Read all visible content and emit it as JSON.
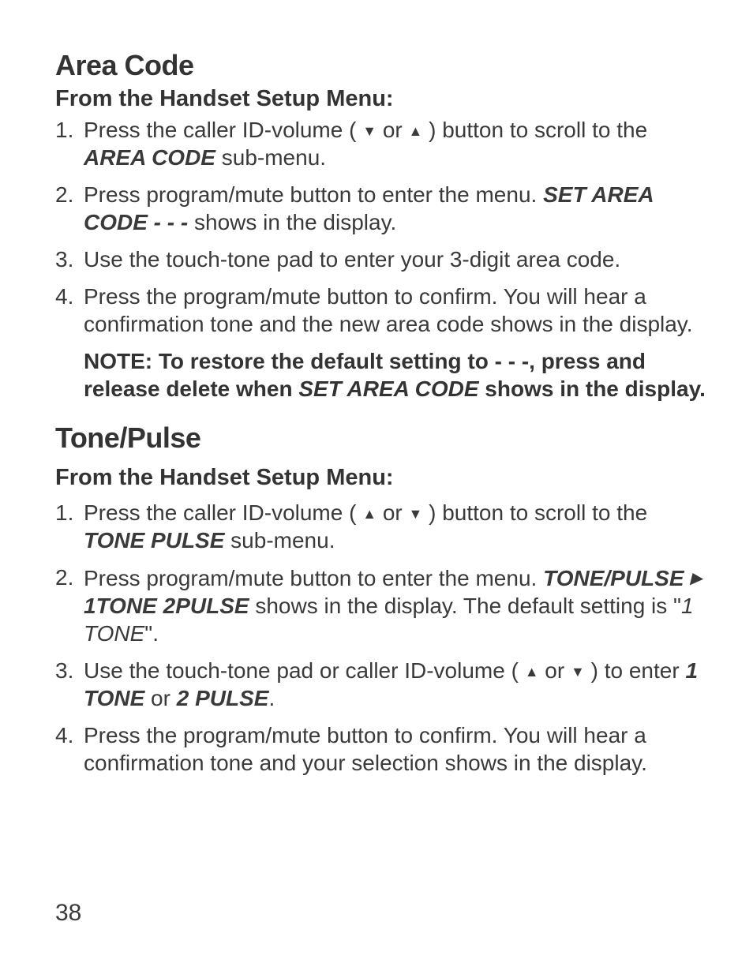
{
  "section1": {
    "title": "Area Code",
    "subhead": "From the Handset Setup Menu:",
    "steps": [
      {
        "pre": "Press the caller ID-volume ( ",
        "a1": "▼",
        "mid": " or ",
        "a2": "▲",
        "post": " ) button to scroll to the ",
        "term": "AREA CODE",
        "tail": " sub-menu."
      },
      {
        "pre": "Press program/mute button to enter the menu. ",
        "term": "SET AREA CODE - - -",
        "tail": " shows in the display."
      },
      {
        "text": "Use the touch-tone pad to enter your 3-digit area code."
      },
      {
        "text": "Press the program/mute button to confirm. You will hear a confirmation tone and the new area code shows in the display."
      }
    ],
    "note_pre": "NOTE: To restore the default setting to - - -, press and release delete when ",
    "note_term": "SET AREA CODE",
    "note_post": " shows in the display."
  },
  "section2": {
    "title": "Tone/Pulse",
    "subhead": "From the Handset Setup Menu:",
    "steps": [
      {
        "pre": "Press the caller ID-volume ( ",
        "a1": "▲",
        "mid": " or ",
        "a2": "▼",
        "post": " ) button to scroll to the ",
        "term": "TONE PULSE",
        "tail": " sub-menu."
      },
      {
        "pre": "Press program/mute button to enter the menu. ",
        "term": "TONE/PULSE ",
        "ra": "▸",
        "term2": " 1TONE 2PULSE",
        "mid2": " shows in the display. The default setting is \"",
        "ital": "1 TONE",
        "tail": "\"."
      },
      {
        "pre": "Use the touch-tone pad or caller ID-volume ( ",
        "a1": "▲",
        "mid": " or ",
        "a2": "▼",
        "post": " ) to enter ",
        "term": "1 TONE",
        "mid3": " or ",
        "term2b": "2 PULSE",
        "tail": "."
      },
      {
        "text": "Press the program/mute button to confirm. You will hear a confirmation tone and your selection shows in the display."
      }
    ]
  },
  "page": "38"
}
